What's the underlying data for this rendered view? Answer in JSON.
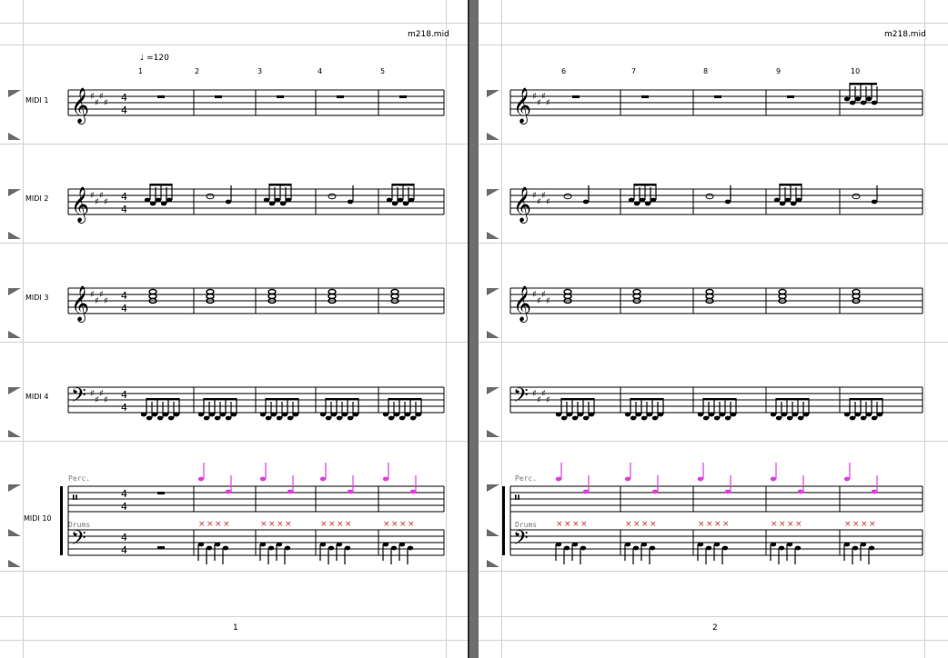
{
  "pages": [
    {
      "filename": "m218.mid",
      "page_number": "1",
      "tempo": "♩ =120",
      "measure_numbers": [
        "1",
        "2",
        "3",
        "4",
        "5"
      ]
    },
    {
      "filename": "m218.mid",
      "page_number": "2",
      "measure_numbers": [
        "6",
        "7",
        "8",
        "9",
        "10"
      ]
    }
  ],
  "tracks": [
    {
      "label": "MIDI 1"
    },
    {
      "label": "MIDI 2"
    },
    {
      "label": "MIDI 3"
    },
    {
      "label": "MIDI 4"
    },
    {
      "label": "MIDI 10"
    }
  ],
  "drum_staves": {
    "upper": "Perc.",
    "lower": "Drums"
  },
  "colors": {
    "accent_note": "#e23ce2",
    "handle": "#6b6b6b",
    "guide": "#d2d2d2"
  }
}
